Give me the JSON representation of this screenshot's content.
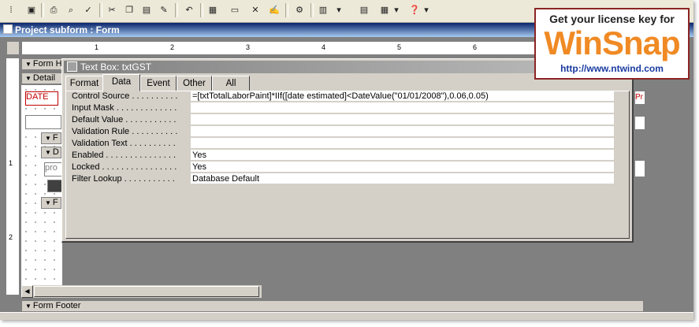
{
  "window": {
    "title": "Project subform : Form"
  },
  "ruler": {
    "h_numbers": [
      "1",
      "2",
      "3",
      "4",
      "5",
      "6"
    ],
    "v_numbers": [
      "1",
      "2"
    ]
  },
  "bands": {
    "form_header": "Form H",
    "detail": "Detail",
    "form_footer": "Form Footer",
    "sub_f1": "F",
    "sub_d": "D",
    "sub_f2": "F"
  },
  "controls": {
    "date_label": "DATE",
    "pro_label": "pro",
    "right_stub": "Pr"
  },
  "dialog": {
    "title": "Text Box: txtGST",
    "tabs": [
      {
        "label": "Format"
      },
      {
        "label": "Data"
      },
      {
        "label": "Event"
      },
      {
        "label": "Other"
      },
      {
        "label": "All"
      }
    ],
    "active_tab": "Data",
    "properties": [
      {
        "label": "Control Source . . . . . . . . . .",
        "value": "=[txtTotalLaborPaint]*IIf([date estimated]<DateValue(\"01/01/2008\"),0.06,0.05)"
      },
      {
        "label": "Input Mask . . . . . . . . . . . . .",
        "value": ""
      },
      {
        "label": "Default Value . . . . . . . . . . .",
        "value": ""
      },
      {
        "label": "Validation Rule . . . . . . . . . .",
        "value": ""
      },
      {
        "label": "Validation Text . . . . . . . . . .",
        "value": ""
      },
      {
        "label": "Enabled . . . . . . . . . . . . . . .",
        "value": "Yes"
      },
      {
        "label": "Locked . . . . . . . . . . . . . . . .",
        "value": "Yes"
      },
      {
        "label": "Filter Lookup . . . . . . . . . . .",
        "value": "Database Default"
      }
    ]
  },
  "watermark": {
    "line1": "Get your license key for",
    "brand": "WinSnap",
    "url": "http://www.ntwind.com"
  },
  "colors": {
    "title_active": "#0a246a",
    "dialog_title": "#808080",
    "brand_orange": "#f08a24",
    "brand_border": "#8b2424"
  }
}
